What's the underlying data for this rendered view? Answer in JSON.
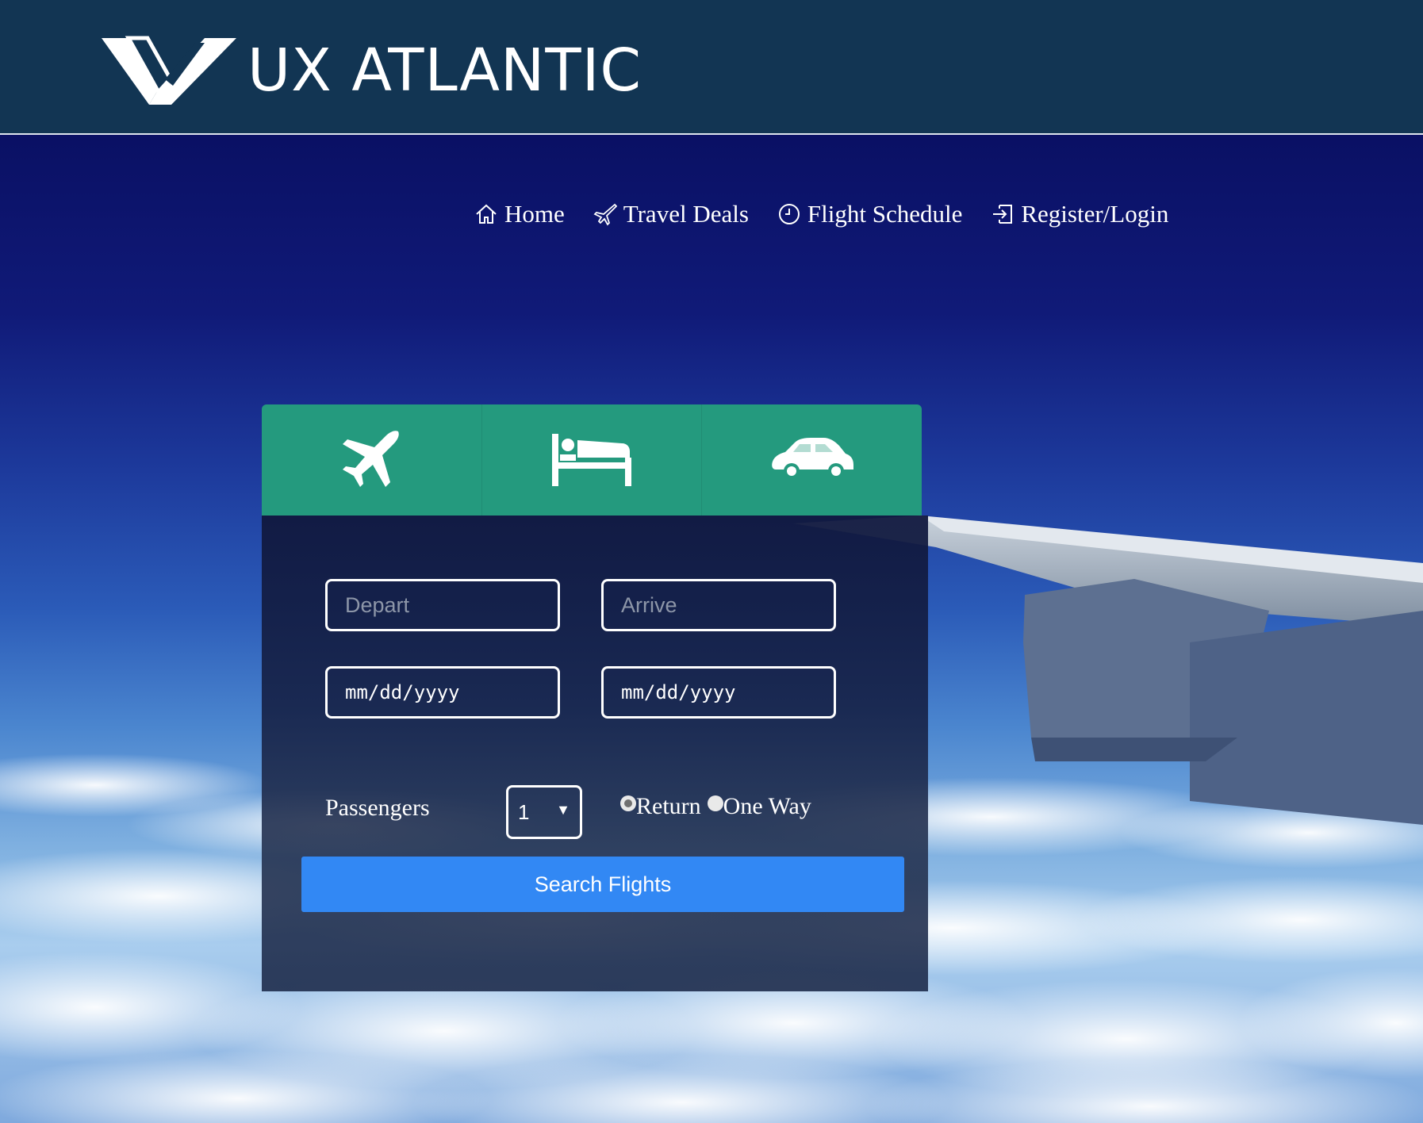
{
  "brand": {
    "name": "UX ATLANTIC"
  },
  "nav": [
    {
      "label": "Home",
      "icon": "home-icon"
    },
    {
      "label": "Travel Deals",
      "icon": "plane-icon"
    },
    {
      "label": "Flight Schedule",
      "icon": "clock-icon"
    },
    {
      "label": "Register/Login",
      "icon": "login-icon"
    }
  ],
  "tabs": [
    {
      "name": "flights",
      "icon": "plane-icon",
      "selected": true
    },
    {
      "name": "hotels",
      "icon": "bed-icon",
      "selected": false
    },
    {
      "name": "cars",
      "icon": "car-icon",
      "selected": false
    }
  ],
  "form": {
    "depart_placeholder": "Depart",
    "arrive_placeholder": "Arrive",
    "depart_date_placeholder": "mm/dd/yyyy",
    "return_date_placeholder": "mm/dd/yyyy",
    "passengers_label": "Passengers",
    "passengers_value": "1",
    "caret": "▼",
    "trip_options": [
      {
        "label": "Return",
        "checked": true
      },
      {
        "label": "One Way",
        "checked": false
      }
    ],
    "search_label": "Search Flights"
  },
  "colors": {
    "header_bg": "#123553",
    "tab_bg": "#249a7e",
    "button_bg": "#3288f4"
  }
}
